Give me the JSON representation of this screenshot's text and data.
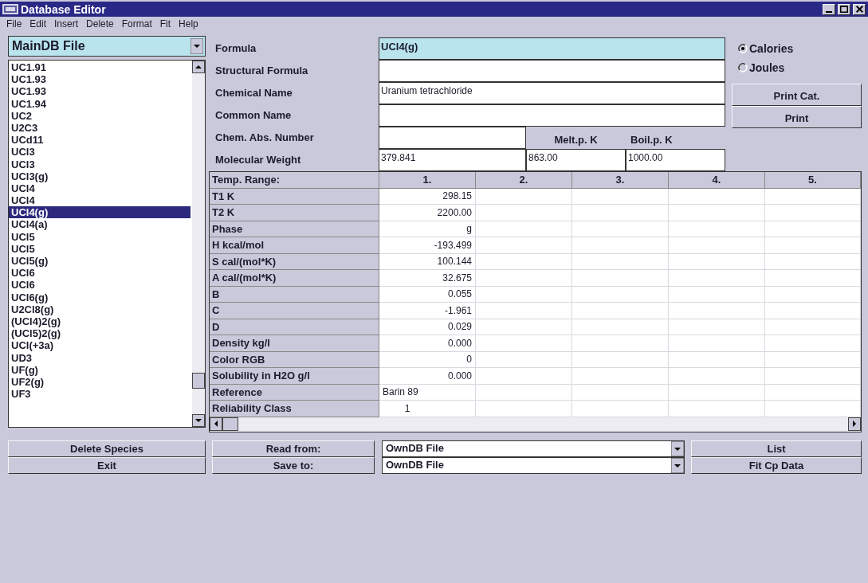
{
  "window": {
    "title": "Database Editor"
  },
  "menu": [
    "File",
    "Edit",
    "Insert",
    "Delete",
    "Format",
    "Fit",
    "Help"
  ],
  "database_select": {
    "value": "MainDB File"
  },
  "species": [
    {
      "label": "UC1.91",
      "selected": false
    },
    {
      "label": "UC1.93",
      "selected": false
    },
    {
      "label": "UC1.93",
      "selected": false
    },
    {
      "label": "UC1.94",
      "selected": false
    },
    {
      "label": "UC2",
      "selected": false
    },
    {
      "label": "U2C3",
      "selected": false
    },
    {
      "label": "UCd11",
      "selected": false
    },
    {
      "label": "UCl3",
      "selected": false
    },
    {
      "label": "UCl3",
      "selected": false
    },
    {
      "label": "UCl3(g)",
      "selected": false
    },
    {
      "label": "UCl4",
      "selected": false
    },
    {
      "label": "UCl4",
      "selected": false
    },
    {
      "label": "UCl4(g)",
      "selected": true
    },
    {
      "label": "UCl4(a)",
      "selected": false
    },
    {
      "label": "UCl5",
      "selected": false
    },
    {
      "label": "UCl5",
      "selected": false
    },
    {
      "label": "UCl5(g)",
      "selected": false
    },
    {
      "label": "UCl6",
      "selected": false
    },
    {
      "label": "UCl6",
      "selected": false
    },
    {
      "label": "UCl6(g)",
      "selected": false
    },
    {
      "label": "U2Cl8(g)",
      "selected": false
    },
    {
      "label": "(UCl4)2(g)",
      "selected": false
    },
    {
      "label": "(UCl5)2(g)",
      "selected": false
    },
    {
      "label": "UCl(+3a)",
      "selected": false
    },
    {
      "label": "UD3",
      "selected": false
    },
    {
      "label": "UF(g)",
      "selected": false
    },
    {
      "label": "UF2(g)",
      "selected": false
    },
    {
      "label": "UF3",
      "selected": false
    }
  ],
  "left_buttons": [
    "Delete Species",
    "Exit"
  ],
  "form": {
    "fields": [
      {
        "label": "Formula",
        "value": "UCl4(g)",
        "focused": true
      },
      {
        "label": "Structural Formula",
        "focused": false
      },
      {
        "label": "Chemical Name",
        "value": "Uranium tetrachloride",
        "focused": false
      },
      {
        "label": "Common Name",
        "focused": false
      }
    ],
    "cas": {
      "label": "Chem. Abs. Number"
    },
    "molecular_weight": {
      "label": "Molecular Weight",
      "value": "379.841"
    },
    "melting_point": {
      "label": "Melt.p. K",
      "value": "863.00"
    },
    "boiling_point": {
      "label": "Boil.p. K",
      "value": "1000.00"
    }
  },
  "units": [
    {
      "label": "Calories",
      "selected": true
    },
    {
      "label": "Joules",
      "selected": false
    }
  ],
  "right_buttons": [
    "Print Cat.",
    "Print"
  ],
  "table": {
    "columns": [
      "Temp. Range:",
      "1.",
      "2.",
      "3.",
      "4.",
      "5."
    ],
    "rows": [
      {
        "label": "T1 K",
        "kind": "number",
        "values": [
          "298.15"
        ]
      },
      {
        "label": "T2 K",
        "kind": "number",
        "values": [
          "2200.00"
        ]
      },
      {
        "label": "Phase",
        "kind": "number",
        "values": [
          "g"
        ]
      },
      {
        "label": "H kcal/mol",
        "kind": "number",
        "values": [
          "-193.499"
        ]
      },
      {
        "label": "S cal/(mol*K)",
        "kind": "number",
        "values": [
          "100.144"
        ]
      },
      {
        "label": "A cal/(mol*K)",
        "kind": "number",
        "values": [
          "32.675"
        ]
      },
      {
        "label": "B",
        "kind": "number",
        "values": [
          "0.055"
        ]
      },
      {
        "label": "C",
        "kind": "number",
        "values": [
          "-1.961"
        ]
      },
      {
        "label": "D",
        "kind": "number",
        "values": [
          "0.029"
        ]
      },
      {
        "label": "Density kg/l",
        "kind": "number",
        "values": [
          "0.000"
        ]
      },
      {
        "label": "Color RGB",
        "kind": "number",
        "values": [
          "0"
        ]
      },
      {
        "label": "Solubility in H2O g/l",
        "kind": "number",
        "values": [
          "0.000"
        ]
      },
      {
        "label": "Reference",
        "kind": "text",
        "values": [
          "Barin 89"
        ]
      },
      {
        "label": "Reliability Class",
        "kind": "class",
        "values": [
          "1"
        ]
      }
    ]
  },
  "read_from": {
    "label": "Read from:",
    "value": "OwnDB File"
  },
  "save_to": {
    "label": "Save to:",
    "value": "OwnDB File"
  },
  "bottom_buttons": [
    "List",
    "Fit Cp Data"
  ]
}
